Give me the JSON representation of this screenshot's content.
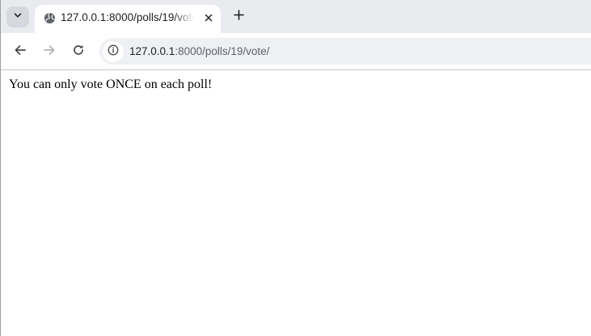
{
  "browser": {
    "tabstrip": {
      "tab_search_icon": "chevron-down-icon",
      "tabs": [
        {
          "title": "127.0.0.1:8000/polls/19/vote/",
          "favicon": "globe-icon",
          "close_icon": "close-icon",
          "active": true
        }
      ],
      "new_tab_icon": "plus-icon"
    },
    "toolbar": {
      "back_icon": "arrow-left-icon",
      "forward_icon": "arrow-right-icon",
      "forward_enabled": false,
      "reload_icon": "reload-icon",
      "site_info_icon": "info-icon",
      "url_host": "127.0.0.1",
      "url_path": ":8000/polls/19/vote/"
    }
  },
  "page": {
    "message": "You can only vote ONCE on each poll!"
  },
  "colors": {
    "tabstrip_bg": "#e9ebef",
    "omnibox_bg": "#eef0f4",
    "icon": "#474747",
    "icon_disabled": "#b2b2b2"
  }
}
